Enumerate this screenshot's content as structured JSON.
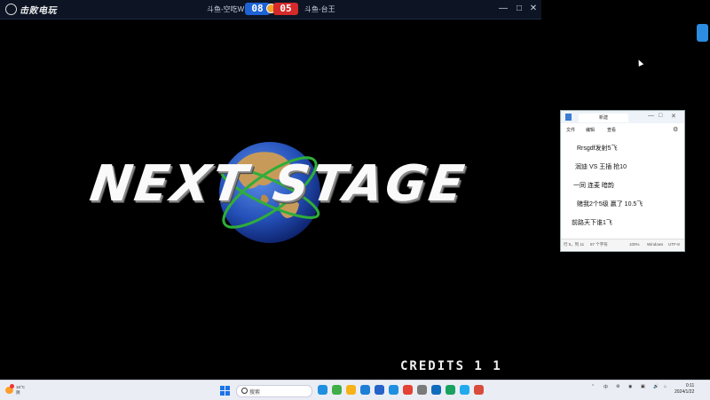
{
  "game": {
    "app_name": "击败电玩",
    "player_left": "斗鱼-空吃W",
    "player_right": "斗鱼-台王",
    "score_left": "08",
    "score_right": "05",
    "window_controls": {
      "minimize": "—",
      "maximize": "□",
      "close": "✕"
    },
    "screen": {
      "word_left": "NEXT",
      "word_right": "STAGE",
      "credits": "CREDITS 1 1"
    }
  },
  "notepad": {
    "tab_title": "新建",
    "menu": [
      "文件",
      "编辑",
      "查看"
    ],
    "lines": [
      "Rrsgdf发射5飞",
      "润迪  VS  王插  抢10",
      "一同 连麦 暗韵",
      "赌我2个5级 赢了 10.5飞",
      "前路天下谁1飞"
    ],
    "status": {
      "position": "行 5，列 11",
      "chars": "87 个字符",
      "zoom": "100%",
      "eol": "Windows",
      "encoding": "UTF-8"
    }
  },
  "taskbar": {
    "weather_temp": "16°C",
    "weather_desc": "阴",
    "search_placeholder": "搜索",
    "app_colors": [
      "#1f8fe0",
      "#3fae49",
      "#f5b21a",
      "#1e7fd6",
      "#2563c9",
      "#1f8fe0",
      "#e34234",
      "#7a7a7a",
      "#0f6cbd",
      "#1aa260",
      "#22aaee",
      "#d94c3d"
    ],
    "tray_text": "中",
    "time": "0:11",
    "date": "2024/1/22"
  },
  "colors": {
    "score_left_bg": "#1e63d6",
    "score_right_bg": "#d42a2a"
  }
}
